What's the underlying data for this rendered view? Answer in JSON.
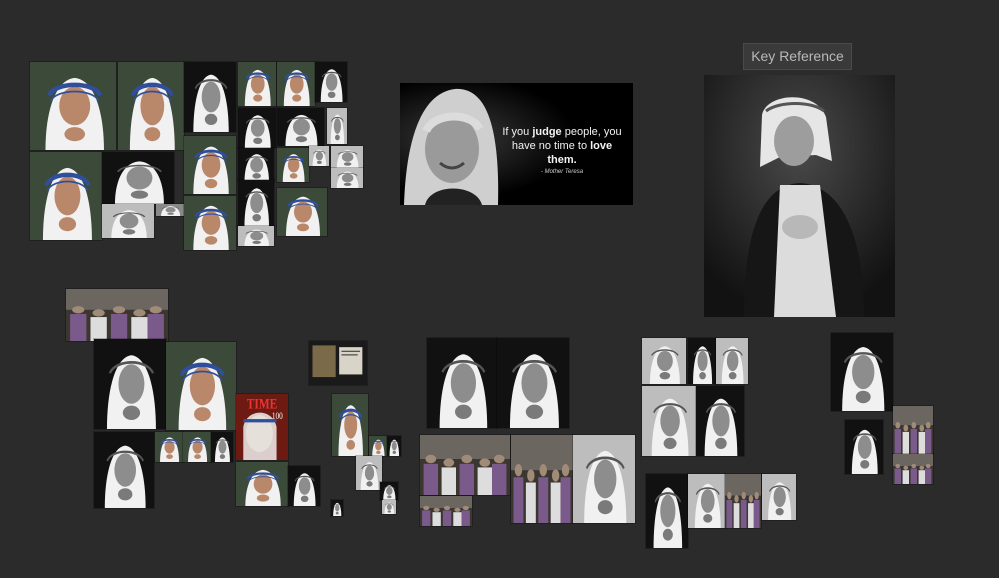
{
  "key_reference": {
    "label": "Key Reference"
  },
  "quote_card": {
    "line1_pre": "If you ",
    "line1_bold": "judge",
    "line1_post": " people, you",
    "line2_pre": "have no time to ",
    "line2_bold": "love them.",
    "attribution": "- Mother Teresa"
  },
  "time_cover": {
    "masthead": "TIME",
    "number": "100"
  },
  "colors": {
    "canvas": "#2b2b2b",
    "label_bg": "#3a3a3a",
    "label_text": "#b9b9b9",
    "sari_blue": "#2f4f9c"
  }
}
